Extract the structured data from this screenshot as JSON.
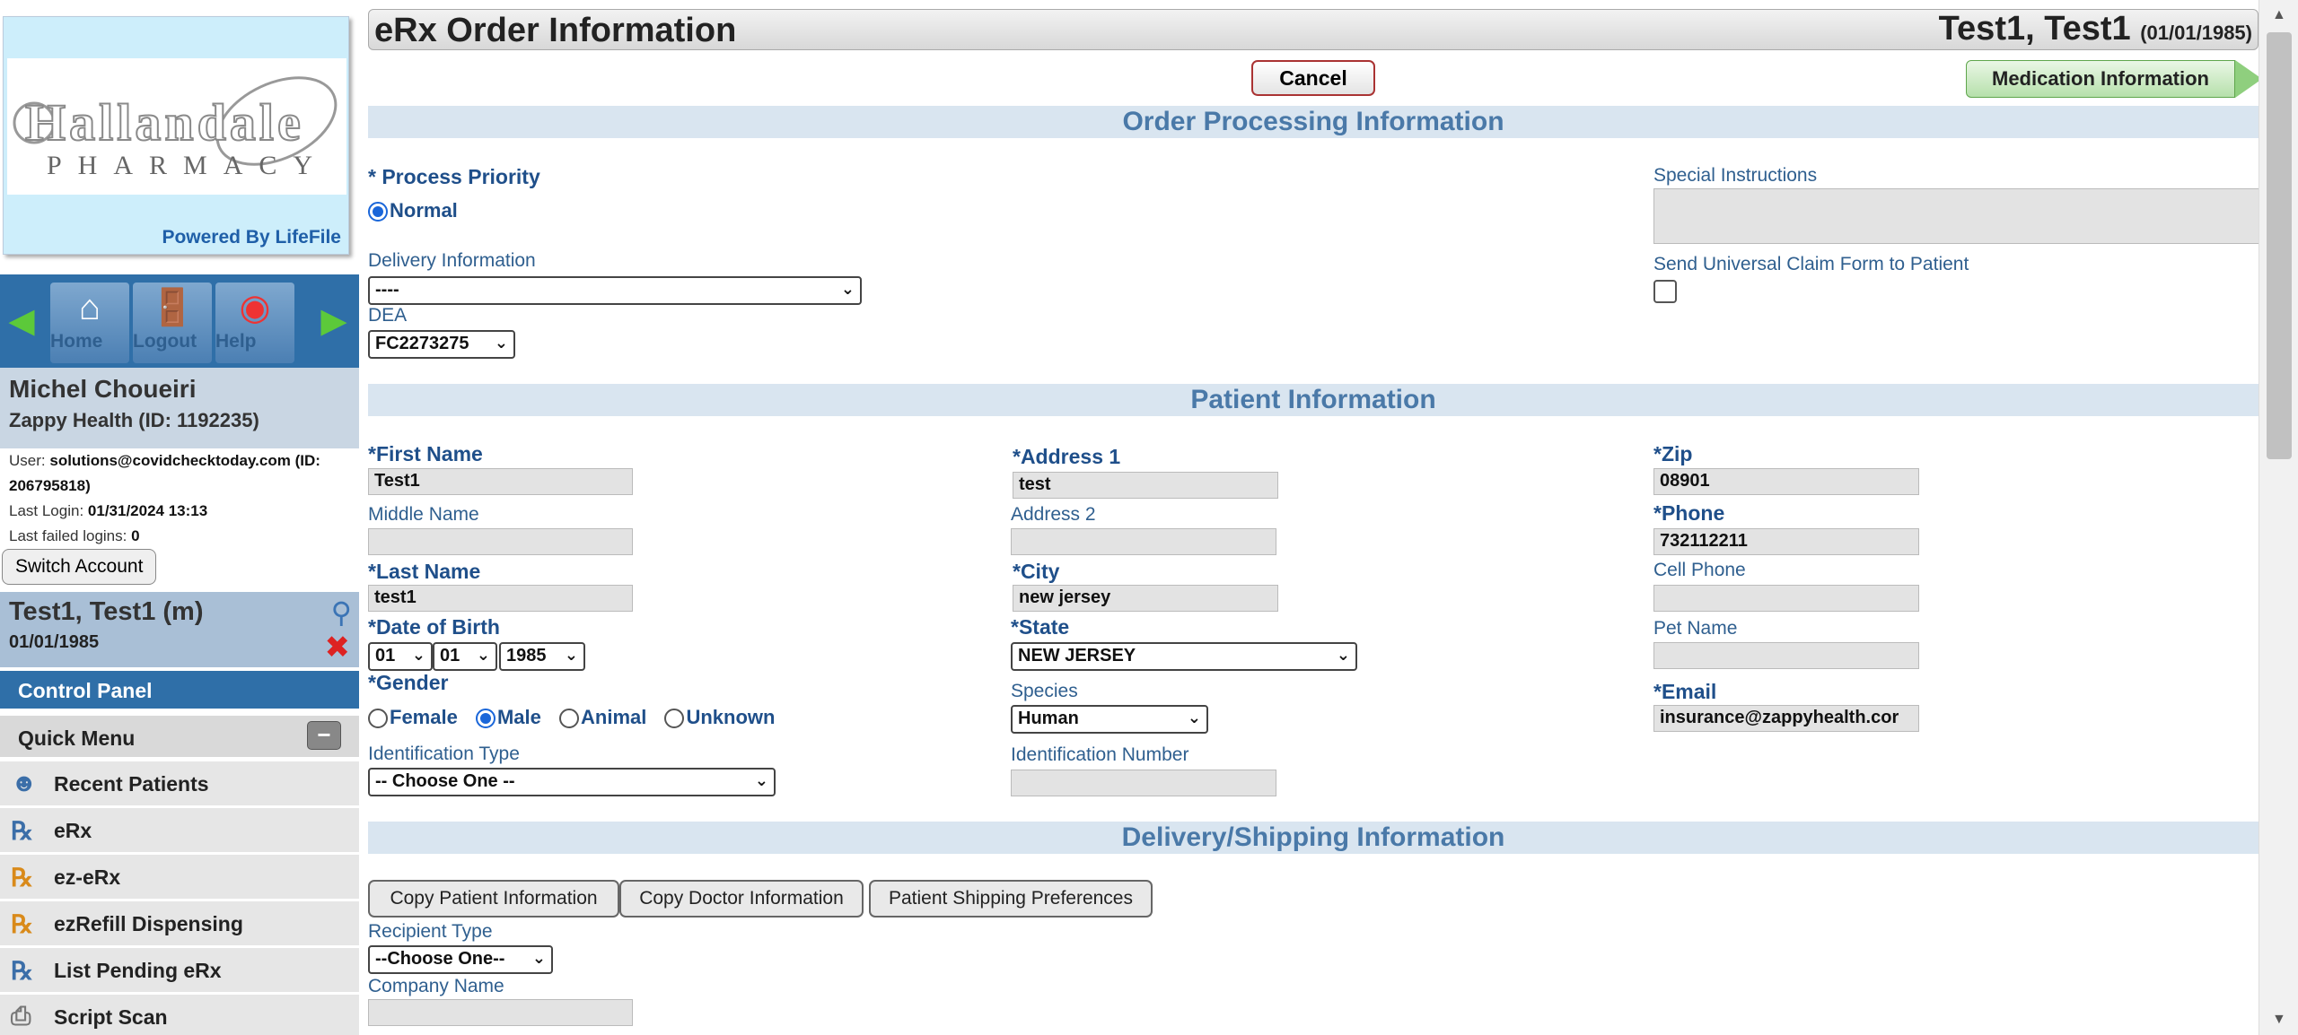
{
  "sidebar": {
    "logo_name": "Hallandale",
    "logo_sub": "PHARMACY",
    "powered_by": "Powered By LifeFile",
    "nav": {
      "home": "Home",
      "logout": "Logout",
      "help": "Help"
    },
    "user_name": "Michel Choueiri",
    "user_org": "Zappy Health (ID: 1192235)",
    "user_label": "User:",
    "user_value": "solutions@covidchecktoday.com (ID: 206795818)",
    "last_login_label": "Last Login:",
    "last_login_value": "01/31/2024 13:13",
    "failed_label": "Last failed logins:",
    "failed_value": "0",
    "switch_account": "Switch Account",
    "patient_name": "Test1, Test1 (m)",
    "patient_dob": "01/01/1985",
    "control_panel": "Control Panel",
    "quick_menu": "Quick Menu",
    "quick_items": [
      "Recent Patients",
      "eRx",
      "ez-eRx",
      "ezRefill Dispensing",
      "List Pending eRx",
      "Script Scan"
    ]
  },
  "header": {
    "title": "eRx Order Information",
    "patient": "Test1, Test1",
    "patient_dob": "(01/01/1985)",
    "cancel": "Cancel",
    "medication_info": "Medication Information"
  },
  "order": {
    "section": "Order Processing Information",
    "priority_label": "* Process Priority",
    "priority_option": "Normal",
    "delivery_label": "Delivery Information",
    "delivery_value": "----",
    "dea_label": "DEA",
    "dea_value": "FC2273275",
    "special_label": "Special Instructions",
    "claim_label": "Send Universal Claim Form to Patient"
  },
  "patient": {
    "section": "Patient Information",
    "first_name_label": "*First Name",
    "first_name": "Test1",
    "middle_name_label": "Middle Name",
    "last_name_label": "*Last Name",
    "last_name": "test1",
    "dob_label": "*Date of Birth",
    "dob_month": "01",
    "dob_day": "01",
    "dob_year": "1985",
    "gender_label": "*Gender",
    "gender_options": [
      "Female",
      "Male",
      "Animal",
      "Unknown"
    ],
    "id_type_label": "Identification Type",
    "id_type_value": "-- Choose One --",
    "address1_label": "*Address 1",
    "address1": "test",
    "address2_label": "Address 2",
    "city_label": "*City",
    "city": "new jersey",
    "state_label": "*State",
    "state": "NEW JERSEY",
    "species_label": "Species",
    "species": "Human",
    "id_number_label": "Identification Number",
    "zip_label": "*Zip",
    "zip": "08901",
    "phone_label": "*Phone",
    "phone": "732112211",
    "cell_label": "Cell Phone",
    "pet_label": "Pet Name",
    "email_label": "*Email",
    "email": "insurance@zappyhealth.cor"
  },
  "delivery": {
    "section": "Delivery/Shipping Information",
    "copy_patient": "Copy Patient Information",
    "copy_doctor": "Copy Doctor Information",
    "shipping_prefs": "Patient Shipping Preferences",
    "recipient_label": "Recipient Type",
    "recipient_value": "--Choose One--",
    "company_label": "Company Name"
  }
}
